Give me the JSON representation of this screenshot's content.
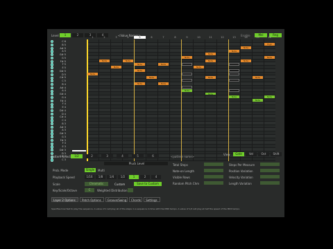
{
  "top": {
    "level_label": "Level",
    "level_tabs": [
      "1",
      "2",
      "3",
      "4"
    ],
    "preset": "<Value Names>",
    "enabled_label": "Enable",
    "btn_a": "Mnl",
    "btn_b": "Rng"
  },
  "grid": {
    "columns": [
      "1",
      "2",
      "3",
      "4",
      "5",
      "6",
      "7",
      "8",
      "9",
      "10",
      "11",
      "12",
      "13",
      "14",
      "15",
      "16"
    ],
    "current_column": 5,
    "row_labels": [
      "C 6",
      "B 5",
      "A# 5",
      "A 5",
      "G# 5",
      "G 5",
      "F# 5",
      "F 5",
      "E 5",
      "D# 5",
      "D 5",
      "C# 5",
      "C 5",
      "B 4",
      "A# 4",
      "A 4",
      "G# 4",
      "G 4",
      "F# 4",
      "F 4",
      "E 4",
      "D# 4",
      "D 4",
      "C# 4",
      "C 4",
      "B 3",
      "A# 3",
      "A 3",
      "G# 3",
      "G 3",
      "F# 3",
      "F 3",
      "E 3",
      "D# 3",
      "D 3",
      "C# 3",
      "C 3"
    ],
    "notes": [
      {
        "row": 1,
        "col": 16,
        "label": "High",
        "style": "o"
      },
      {
        "row": 2,
        "col": 14,
        "label": "Note",
        "style": "o"
      },
      {
        "row": 3,
        "col": 13,
        "label": "Note",
        "style": "o"
      },
      {
        "row": 4,
        "col": 11,
        "label": "Note",
        "style": "o"
      },
      {
        "row": 5,
        "col": 9,
        "label": "Note",
        "style": "o"
      },
      {
        "row": 5,
        "col": 16,
        "label": "Note",
        "style": "o"
      },
      {
        "row": 6,
        "col": 2,
        "label": "Note",
        "style": "o"
      },
      {
        "row": 6,
        "col": 4,
        "label": "Note",
        "style": "o"
      },
      {
        "row": 6,
        "col": 11,
        "label": "Note",
        "style": "o"
      },
      {
        "row": 6,
        "col": 14,
        "label": "Note",
        "style": "o"
      },
      {
        "row": 7,
        "col": 5,
        "label": "Note",
        "style": "o"
      },
      {
        "row": 7,
        "col": 7,
        "label": "Note",
        "style": "o"
      },
      {
        "row": 7,
        "col": 9,
        "label": "",
        "style": "gh"
      },
      {
        "row": 7,
        "col": 13,
        "label": "",
        "style": "gh"
      },
      {
        "row": 8,
        "col": 3,
        "label": "Note",
        "style": "o"
      },
      {
        "row": 8,
        "col": 10,
        "label": "Note",
        "style": "o"
      },
      {
        "row": 9,
        "col": 5,
        "label": "Note",
        "style": "o"
      },
      {
        "row": 9,
        "col": 13,
        "label": "",
        "style": "gh"
      },
      {
        "row": 10,
        "col": 1,
        "label": "Note",
        "style": "o"
      },
      {
        "row": 10,
        "col": 9,
        "label": "",
        "style": "gh"
      },
      {
        "row": 10,
        "col": 13,
        "label": "",
        "style": "gh"
      },
      {
        "row": 11,
        "col": 6,
        "label": "Note",
        "style": "o"
      },
      {
        "row": 11,
        "col": 11,
        "label": "Note",
        "style": "o"
      },
      {
        "row": 11,
        "col": 15,
        "label": "Note",
        "style": "o"
      },
      {
        "row": 12,
        "col": 9,
        "label": "",
        "style": "gh"
      },
      {
        "row": 12,
        "col": 13,
        "label": "",
        "style": "gh"
      },
      {
        "row": 13,
        "col": 5,
        "label": "Note",
        "style": "o"
      },
      {
        "row": 13,
        "col": 7,
        "label": "Note",
        "style": "o"
      },
      {
        "row": 14,
        "col": 9,
        "label": "",
        "style": "gh"
      },
      {
        "row": 15,
        "col": 9,
        "label": "Note",
        "style": "g2"
      },
      {
        "row": 15,
        "col": 13,
        "label": "",
        "style": "gh"
      },
      {
        "row": 16,
        "col": 11,
        "label": "Note",
        "style": "g2"
      },
      {
        "row": 17,
        "col": 13,
        "label": "Note",
        "style": "g2"
      },
      {
        "row": 17,
        "col": 16,
        "label": "Note",
        "style": "g2"
      },
      {
        "row": 18,
        "col": 15,
        "label": "Note",
        "style": "g2"
      }
    ]
  },
  "pattern": {
    "label": "Pattern Select",
    "buttons": [
      "1/2",
      "2",
      "3",
      "4",
      "5",
      "6"
    ],
    "active": 0,
    "name": "<pattern name>"
  },
  "view": {
    "label": "View",
    "buttons": [
      "Gate",
      "Vel",
      "Oct",
      "Shift"
    ],
    "active": 0
  },
  "playlabel": "Pluck Level",
  "left_params": [
    {
      "label": "Prob. Mode",
      "value": "Single",
      "alt": "Multi"
    },
    {
      "label": "Playback Speed",
      "steps": [
        "1/16",
        "1/8",
        "1/4",
        "1/2",
        "1",
        "2",
        "4"
      ],
      "active": 4
    },
    {
      "label": "Scale",
      "value": "Chromatic",
      "extra": "Custom",
      "btn": "Save to Custom"
    },
    {
      "label": "Key/Scale/Octave",
      "value": "C",
      "extra2": "Weighted Distribution"
    }
  ],
  "mid_params": [
    {
      "label": "Total Steps",
      "value": "16"
    },
    {
      "label": "Note-on Length",
      "value": "50"
    },
    {
      "label": "Visible Rows",
      "value": "37"
    },
    {
      "label": "Random Pitch Chm",
      "value": "0"
    }
  ],
  "right_params": [
    {
      "label": "Steps Per Measure",
      "value": "16"
    },
    {
      "label": "Position Variation",
      "value": "0"
    },
    {
      "label": "Velocity Variation",
      "value": "0"
    },
    {
      "label": "Length Variation",
      "value": "0"
    }
  ],
  "tabs": [
    "Layer 2 Options",
    "Patch Options",
    "Groove/Swing",
    "Chords",
    "Settings"
  ],
  "status": "Specifies how fast to play the sequence. A value of 1 will play all of the steps in a sequence in time with the MIDI tempo. A value of 1/2 will play at half the speed of the MIDI tempo."
}
